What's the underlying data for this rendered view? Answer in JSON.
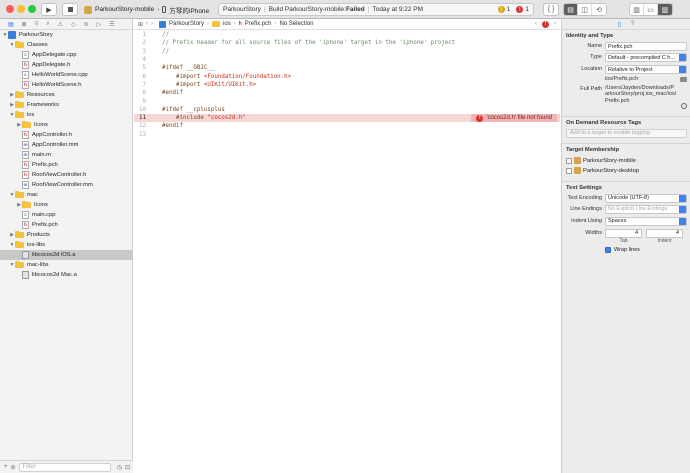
{
  "toolbar": {
    "scheme_name": "ParkourStory-mobile",
    "device_name": "方琴的iPhone",
    "activity_project": "ParkourStory",
    "activity_status_prefix": "Build ParkourStory-mobile: ",
    "activity_status_failed": "Failed",
    "activity_time": "Today at 9:22 PM",
    "warning_count": "1",
    "error_count": "1",
    "error_color": "#d8302b",
    "warning_color": "#e0a418"
  },
  "navigator": {
    "rows": [
      {
        "label": "ParkourStory",
        "type": "project",
        "level": 0,
        "disclosure": "open"
      },
      {
        "label": "Classes",
        "type": "folder",
        "level": 1,
        "disclosure": "open"
      },
      {
        "label": "AppDelegate.cpp",
        "type": "file-c",
        "level": 2
      },
      {
        "label": "AppDelegate.h",
        "type": "file-h",
        "level": 2
      },
      {
        "label": "HelloWorldScene.cpp",
        "type": "file-c",
        "level": 2
      },
      {
        "label": "HelloWorldScene.h",
        "type": "file-h",
        "level": 2
      },
      {
        "label": "Resources",
        "type": "folder",
        "level": 1,
        "disclosure": "closed"
      },
      {
        "label": "Frameworks",
        "type": "folder",
        "level": 1,
        "disclosure": "closed"
      },
      {
        "label": "ios",
        "type": "folder",
        "level": 1,
        "disclosure": "open"
      },
      {
        "label": "Icons",
        "type": "folder",
        "level": 2,
        "disclosure": "closed"
      },
      {
        "label": "AppController.h",
        "type": "file-h",
        "level": 2
      },
      {
        "label": "AppController.mm",
        "type": "file-m",
        "level": 2
      },
      {
        "label": "main.m",
        "type": "file-m",
        "level": 2
      },
      {
        "label": "Prefix.pch",
        "type": "file-h",
        "level": 2
      },
      {
        "label": "RootViewController.h",
        "type": "file-h",
        "level": 2
      },
      {
        "label": "RootViewController.mm",
        "type": "file-m",
        "level": 2
      },
      {
        "label": "mac",
        "type": "folder",
        "level": 1,
        "disclosure": "open"
      },
      {
        "label": "Icons",
        "type": "folder",
        "level": 2,
        "disclosure": "closed"
      },
      {
        "label": "main.cpp",
        "type": "file-c",
        "level": 2
      },
      {
        "label": "Prefix.pch",
        "type": "file-h",
        "level": 2
      },
      {
        "label": "Products",
        "type": "folder",
        "level": 1,
        "disclosure": "closed"
      },
      {
        "label": "ios-libs",
        "type": "folder",
        "level": 1,
        "disclosure": "open"
      },
      {
        "label": "libcocos2d iOS.a",
        "type": "lib",
        "level": 2,
        "selected": true
      },
      {
        "label": "mac-libs",
        "type": "folder",
        "level": 1,
        "disclosure": "open"
      },
      {
        "label": "libcocos2d Mac.a",
        "type": "lib",
        "level": 2
      }
    ],
    "filter_placeholder": "Filter"
  },
  "editor": {
    "breadcrumb": [
      "ParkourStory",
      "ios",
      "Prefix.pch",
      "No Selection"
    ],
    "lines": [
      {
        "n": "1",
        "parts": [
          {
            "t": "//",
            "c": "cm"
          }
        ]
      },
      {
        "n": "2",
        "parts": [
          {
            "t": "// Prefix header for all source files of the 'iphone' target in the 'iphone' project",
            "c": "cm"
          }
        ]
      },
      {
        "n": "3",
        "parts": [
          {
            "t": "//",
            "c": "cm"
          }
        ]
      },
      {
        "n": "4",
        "parts": []
      },
      {
        "n": "5",
        "parts": [
          {
            "t": "#ifdef __OBJC__",
            "c": "pp"
          }
        ]
      },
      {
        "n": "6",
        "parts": [
          {
            "t": "    #import ",
            "c": "pp"
          },
          {
            "t": "<Foundation/Foundation.h>",
            "c": "st"
          }
        ]
      },
      {
        "n": "7",
        "parts": [
          {
            "t": "    #import ",
            "c": "pp"
          },
          {
            "t": "<UIKit/UIKit.h>",
            "c": "st"
          }
        ]
      },
      {
        "n": "8",
        "parts": [
          {
            "t": "#endif",
            "c": "pp"
          }
        ]
      },
      {
        "n": "9",
        "parts": []
      },
      {
        "n": "10",
        "parts": [
          {
            "t": "#ifdef __cplusplus",
            "c": "pp"
          }
        ]
      },
      {
        "n": "11",
        "parts": [
          {
            "t": "    #include ",
            "c": "pp"
          },
          {
            "t": "\"cocos2d.h\"",
            "c": "st"
          }
        ],
        "error": "'cocos2d.h' file not found",
        "current": true
      },
      {
        "n": "12",
        "parts": [
          {
            "t": "#endif",
            "c": "pp"
          }
        ]
      },
      {
        "n": "13",
        "parts": []
      }
    ]
  },
  "inspector": {
    "identity_title": "Identity and Type",
    "name_label": "Name",
    "name_value": "Prefix.pch",
    "type_label": "Type",
    "type_value": "Default - precompiled C h...",
    "location_label": "Location",
    "location_value": "Relative to Project",
    "location_path": "ios/Prefix.pch",
    "fullpath_label": "Full Path",
    "fullpath_value": "/Users/Jayden/Downloads/ParkourStory/proj.ios_mac/ios/Prefix.pch",
    "tags_title": "On Demand Resource Tags",
    "tags_placeholder": "Add to a target to enable tagging",
    "membership_title": "Target Membership",
    "targets": [
      {
        "label": "ParkourStory-mobile",
        "checked": false
      },
      {
        "label": "ParkourStory-desktop",
        "checked": false
      }
    ],
    "textsettings_title": "Text Settings",
    "encoding_label": "Text Encoding",
    "encoding_value": "Unicode (UTF-8)",
    "lineendings_label": "Line Endings",
    "lineendings_value": "No Explicit Line Endings",
    "indentusing_label": "Indent Using",
    "indentusing_value": "Spaces",
    "widths_label": "Widths",
    "tab_value": "4",
    "indent_value": "4",
    "tab_label": "Tab",
    "indent_label": "Indent",
    "wrap_label": "Wrap lines",
    "wrap_checked": true
  }
}
